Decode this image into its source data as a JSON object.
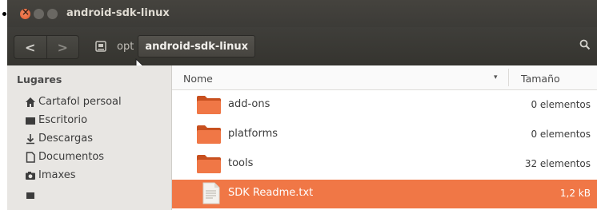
{
  "window": {
    "title": "android-sdk-linux"
  },
  "toolbar": {
    "back": "<",
    "forward": ">",
    "breadcrumbs": [
      "opt",
      "android-sdk-linux"
    ],
    "search_icon": "search-icon"
  },
  "sidebar": {
    "header": "Lugares",
    "items": [
      {
        "label": "Cartafol persoal",
        "icon": "home-icon"
      },
      {
        "label": "Escritorio",
        "icon": "desktop-icon"
      },
      {
        "label": "Descargas",
        "icon": "download-icon"
      },
      {
        "label": "Documentos",
        "icon": "document-icon"
      },
      {
        "label": "Imaxes",
        "icon": "camera-icon"
      }
    ]
  },
  "list": {
    "columns": {
      "name": "Nome",
      "size": "Tamaño"
    },
    "rows": [
      {
        "name": "add-ons",
        "size": "0 elementos",
        "type": "folder"
      },
      {
        "name": "platforms",
        "size": "0 elementos",
        "type": "folder"
      },
      {
        "name": "tools",
        "size": "32 elementos",
        "type": "folder"
      },
      {
        "name": "SDK Readme.txt",
        "size": "1,2 kB",
        "type": "text-file",
        "selected": true
      }
    ]
  },
  "colors": {
    "accent": "#f07746",
    "titlebar": "#3c3b37",
    "folder": "#e8673a"
  }
}
